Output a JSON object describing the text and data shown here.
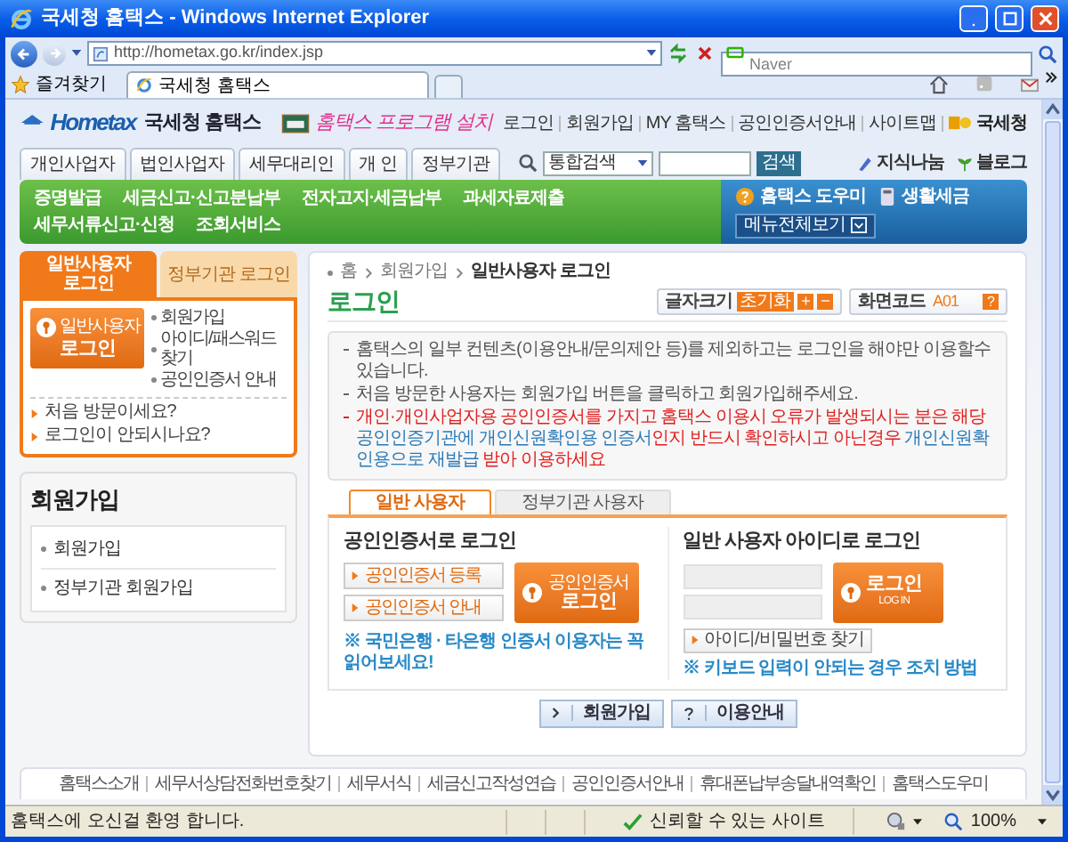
{
  "browser": {
    "title": "국세청 홈택스 - Windows Internet Explorer",
    "address": "http://hometax.go.kr/index.jsp",
    "search_placeholder": "Naver",
    "favorites": "즐겨찾기",
    "tabs": [
      {
        "label": "국세청 홈택스",
        "selected": true
      }
    ]
  },
  "header": {
    "logo": "Hometax",
    "site_name": "국세청 홈택스",
    "banner": "홈택스 프로그램 설치",
    "top_links": [
      "로그인",
      "회원가입",
      "MY 홈택스",
      "공인인증서안내",
      "사이트맵"
    ],
    "agency": "국세청"
  },
  "nav": {
    "tabs": [
      "개인사업자",
      "법인사업자",
      "세무대리인",
      "개 인",
      "정부기관"
    ],
    "search_scope": "통합검색",
    "search_button": "검색",
    "links": [
      "지식나눔",
      "블로그"
    ]
  },
  "menu": {
    "items": [
      "증명발급",
      "세금신고·신고분납부",
      "전자고지·세금납부",
      "과세자료제출",
      "세무서류신고·신청",
      "조회서비스"
    ],
    "helper": "홈택스 도우미",
    "life_tax": "생활세금",
    "all_menu": "메뉴전체보기"
  },
  "sidebar": {
    "login_tabs": [
      {
        "label": "일반사용자 로그인",
        "selected": true
      },
      {
        "label": "정부기관 로그인",
        "selected": false
      }
    ],
    "login_button": {
      "caption": "일반사용자",
      "label": "로그인"
    },
    "links": [
      "회원가입",
      "아이디/패스워드 찾기",
      "공인인증서 안내"
    ],
    "help_links": [
      "처음 방문이세요?",
      "로그인이 안되시나요?"
    ],
    "section": {
      "title": "회원가입",
      "items": [
        "회원가입",
        "정부기관 회원가입"
      ]
    }
  },
  "main": {
    "breadcrumb": [
      "홈",
      "회원가입",
      "일반사용자 로그인"
    ],
    "title": "로그인",
    "font_size": {
      "label": "글자크기",
      "reset": "초기화",
      "plus": "+",
      "minus": "−"
    },
    "screen_code": {
      "label": "화면코드",
      "value": "A01",
      "help": "?"
    },
    "notices": [
      {
        "kind": "plain",
        "text": "홈택스의 일부 컨텐츠(이용안내/문의제안 등)를 제외하고는 로그인을 해야만 이용할수 있습니다."
      },
      {
        "kind": "plain",
        "text": "처음 방문한 사용자는 회원가입 버튼을 클릭하고 회원가입해주세요."
      },
      {
        "kind": "warning",
        "segments": [
          {
            "text": "개인·개인사업자용 공인인증서를 가지고 홈택스 이용시 오류가 발생되시는 분은 해당 ",
            "highlight": false
          },
          {
            "text": "공인인증기관에 개인신원확인용 인증서",
            "highlight": true
          },
          {
            "text": "인지 반드시 확인하시고 아닌경우 ",
            "highlight": false
          },
          {
            "text": "개인신원확인용으로 재발급",
            "highlight": true
          },
          {
            "text": " 받아 이용하세요",
            "highlight": false
          }
        ]
      }
    ],
    "login_tabs": [
      {
        "label": "일반 사용자",
        "selected": true
      },
      {
        "label": "정부기관 사용자",
        "selected": false
      }
    ],
    "cert_login": {
      "title": "공인인증서로 로그인",
      "buttons": [
        "공인인증서 등록",
        "공인인증서 안내"
      ],
      "login_button": {
        "caption": "공인인증서",
        "label": "로그인"
      },
      "note": "※ 국민은행 · 타은행 인증서 이용자는 꼭 읽어보세요!"
    },
    "id_login": {
      "title": "일반 사용자 아이디로 로그인",
      "login_button": {
        "label": "로그인",
        "caption": "LOG IN"
      },
      "find_button": "아이디/비밀번호 찾기",
      "note": "※ 키보드 입력이 안되는 경우 조치 방법"
    },
    "bottom_buttons": [
      {
        "kind": "join",
        "label": "회원가입"
      },
      {
        "kind": "help",
        "label": "이용안내"
      }
    ]
  },
  "footer": {
    "links": [
      "홈택스소개",
      "세무서상담전화번호찾기",
      "세무서식",
      "세금신고작성연습",
      "공인인증서안내",
      "휴대폰납부송달내역확인",
      "홈택스도우미"
    ]
  },
  "status_bar": {
    "text": "홈택스에 오신걸 환영 합니다.",
    "zone": "신뢰할 수 있는 사이트",
    "zoom": "100%"
  }
}
